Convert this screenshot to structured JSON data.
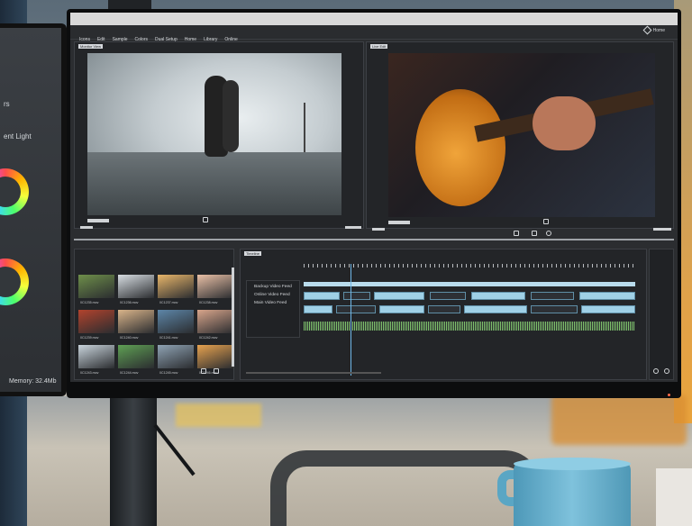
{
  "left_monitor": {
    "line1": "rs",
    "line2": "ent Light",
    "memory": "Memory: 32.4Mb"
  },
  "menu": {
    "items": [
      "Icons",
      "Edit",
      "Sample",
      "Colors",
      "Dual Setup",
      "Home",
      "Library",
      "Online"
    ],
    "home_label": "Home"
  },
  "panels": {
    "left_tag": "Monitor View",
    "right_tag": "Live Edit"
  },
  "media_bin": {
    "items": [
      {
        "label": "0C1235.mov",
        "color": "#6e8f4a"
      },
      {
        "label": "0C1236.mov",
        "color": "#d7dde2"
      },
      {
        "label": "0C1237.mov",
        "color": "#e8b66a"
      },
      {
        "label": "0C1238.mov",
        "color": "#e9c0a6"
      },
      {
        "label": "0C1239.mov",
        "color": "#b2432d"
      },
      {
        "label": "0C1240.mov",
        "color": "#d9b48a"
      },
      {
        "label": "0C1241.mov",
        "color": "#5d86a8"
      },
      {
        "label": "0C1242.mov",
        "color": "#d8a58b"
      },
      {
        "label": "0C1243.mov",
        "color": "#c9d4dc"
      },
      {
        "label": "0C1244.mov",
        "color": "#5fa054"
      },
      {
        "label": "0C1245.mov",
        "color": "#8fa3b4"
      },
      {
        "label": "0C1246.mov",
        "color": "#e6a24f"
      }
    ]
  },
  "timeline": {
    "tag": "Timeline",
    "tracks": [
      "Backup Video Feed",
      "Online Video Feed",
      "Main Video Feed"
    ]
  },
  "colors": {
    "clip": "#9fd0e6",
    "clip_dark": "#2d3035",
    "audio": "#7ec36c",
    "playhead": "#6fb7e8"
  }
}
